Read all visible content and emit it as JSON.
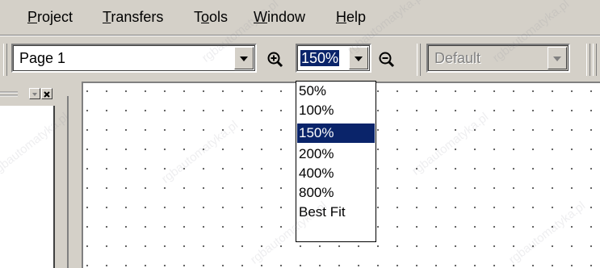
{
  "menu": {
    "items": [
      {
        "key": "P",
        "rest": "roject"
      },
      {
        "key": "T",
        "rest": "ransfers"
      },
      {
        "pre": "T",
        "key": "o",
        "rest": "ols"
      },
      {
        "key": "W",
        "rest": "indow"
      },
      {
        "key": "H",
        "rest": "elp"
      }
    ]
  },
  "toolbar": {
    "page_combo_value": "Page 1",
    "zoom_combo_value": "150%",
    "style_combo_value": "Default"
  },
  "zoom_dropdown": {
    "options": [
      "50%",
      "100%",
      "150%",
      "200%",
      "400%",
      "800%",
      "Best Fit"
    ],
    "selected": "150%"
  },
  "watermark": "rgbautomatyka.pl",
  "colors": {
    "selection": "#0a246a",
    "chrome": "#d4d0c8"
  }
}
